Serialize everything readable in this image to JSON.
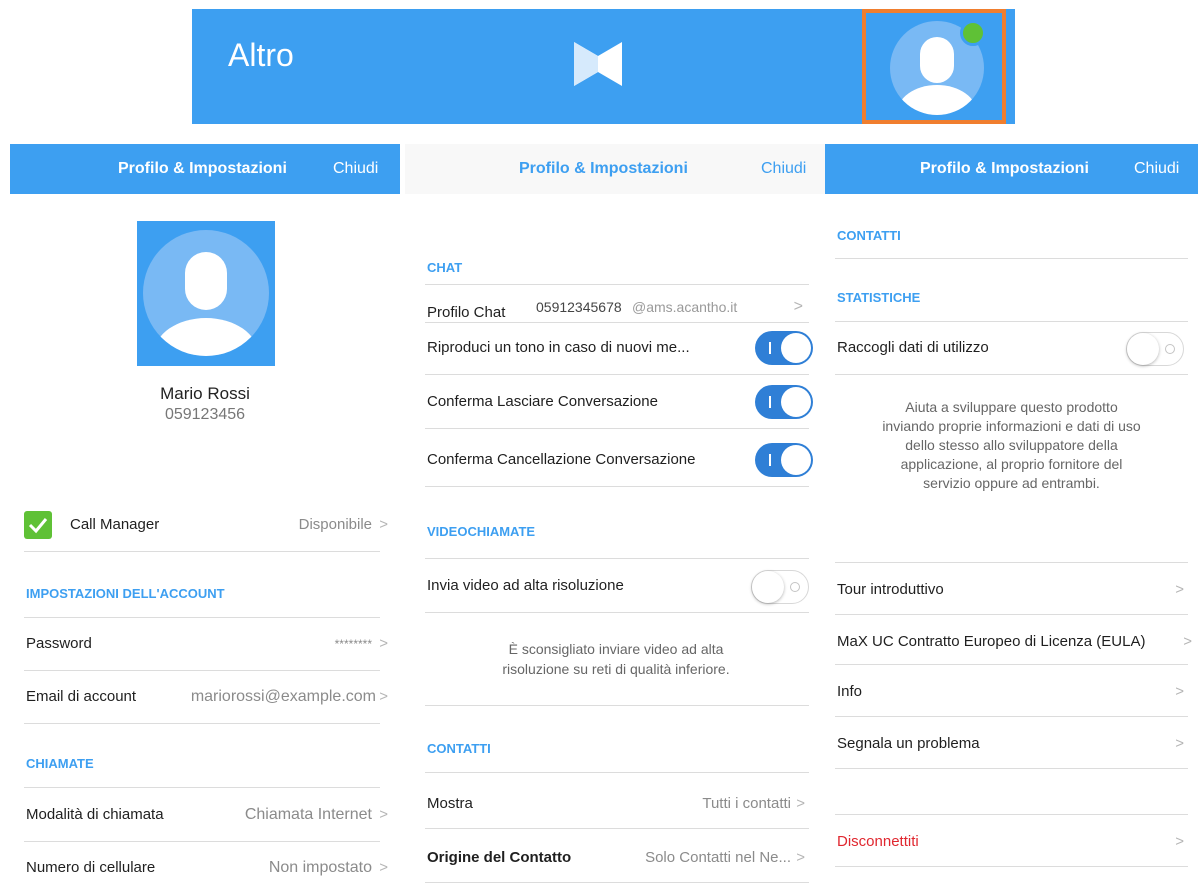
{
  "topbar": {
    "title": "Altro",
    "bg_color": "#3d9ff1",
    "highlight_color": "#f07e2e",
    "presence_color": "#5fc136",
    "logo_icon": "max-logo-icon",
    "avatar_icon": "user-avatar-icon"
  },
  "nav": {
    "title": "Profilo & Impostazioni",
    "close_label": "Chiudi"
  },
  "profile": {
    "name": "Mario Rossi",
    "number": "059123456",
    "call_manager": {
      "label": "Call Manager",
      "value": "Disponibile",
      "checked": true
    },
    "account_section": "IMPOSTAZIONI DELL'ACCOUNT",
    "password": {
      "label": "Password",
      "value": "********"
    },
    "email": {
      "label": "Email di account",
      "value": "mariorossi@example.com"
    },
    "calls_section": "CHIAMATE",
    "call_mode": {
      "label": "Modalità di chiamata",
      "value": "Chiamata Internet"
    },
    "mobile": {
      "label": "Numero di cellulare",
      "value": "Non impostato"
    }
  },
  "settings": {
    "chat_section": "CHAT",
    "chat_profile": {
      "label": "Profilo Chat",
      "number": "05912345678",
      "domain": "@ams.acantho.it"
    },
    "toggles": [
      {
        "label": "Riproduci un tono in caso di nuovi me...",
        "on": true
      },
      {
        "label": "Conferma Lasciare Conversazione",
        "on": true
      },
      {
        "label": "Conferma Cancellazione Conversazione",
        "on": true
      }
    ],
    "video_section": "VIDEOCHIAMATE",
    "hd_video": {
      "label": "Invia video ad alta risoluzione",
      "on": false
    },
    "video_note_line1": "È sconsigliato inviare video ad alta",
    "video_note_line2": "risoluzione su reti di qualità inferiore.",
    "contacts_section": "CONTATTI",
    "show": {
      "label": "Mostra",
      "value": "Tutti i contatti"
    },
    "origin": {
      "label": "Origine del Contatto",
      "value": "Solo Contatti nel Ne..."
    }
  },
  "more": {
    "contacts_section": "CONTATTI",
    "stats_section": "STATISTICHE",
    "collect": {
      "label": "Raccogli dati di utilizzo",
      "on": false
    },
    "note_lines": [
      "Aiuta a sviluppare questo prodotto",
      "inviando proprie informazioni e dati di uso",
      "dello stesso allo sviluppatore della",
      "applicazione, al proprio fornitore del",
      "servizio oppure ad entrambi."
    ],
    "tour": "Tour introduttivo",
    "eula": "MaX UC Contratto Europeo di Licenza (EULA)",
    "info": "Info",
    "report": "Segnala un problema",
    "logout": "Disconnettiti",
    "logout_color": "#e0272f"
  }
}
